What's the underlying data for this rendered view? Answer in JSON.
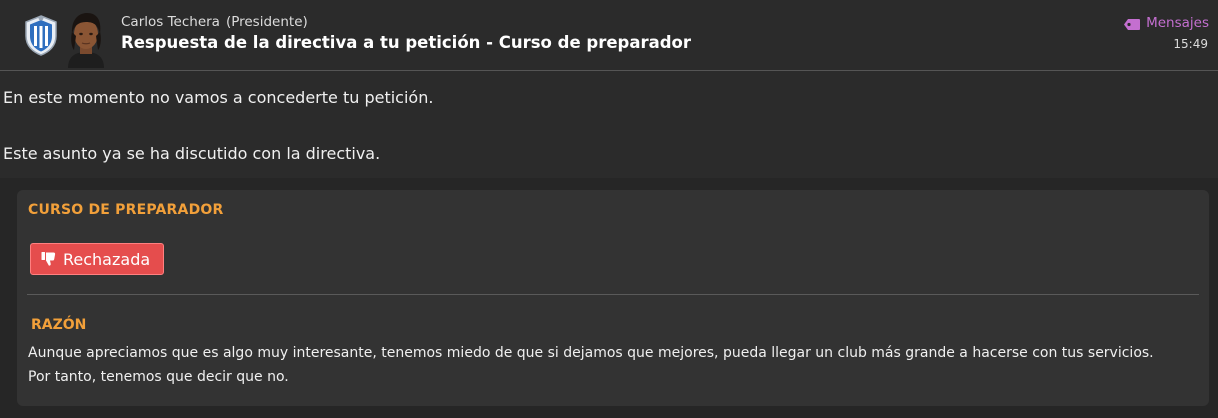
{
  "header": {
    "sender_name": "Carlos Techera",
    "sender_role": "(Presidente)",
    "subject": "Respuesta de la directiva a tu petición - Curso de preparador",
    "category_label": "Mensajes",
    "time": "15:49",
    "accent_color": "#c46fd0"
  },
  "body": {
    "paragraph_1": "En este momento no vamos a concederte tu petición.",
    "paragraph_2": "Este asunto ya se ha discutido con la directiva."
  },
  "panel": {
    "title": "CURSO DE PREPARADOR",
    "status_label": "Rechazada",
    "status_icon": "thumbs-down-icon",
    "status_color": "#e54d4d",
    "reason_title": "RAZÓN",
    "reason_line_1": "Aunque apreciamos que es algo muy interesante, tenemos miedo de que si dejamos que mejores, pueda llegar un club más grande a hacerse con tus servicios.",
    "reason_line_2": "Por tanto, tenemos que decir que no.",
    "heading_color": "#f2a03a"
  }
}
